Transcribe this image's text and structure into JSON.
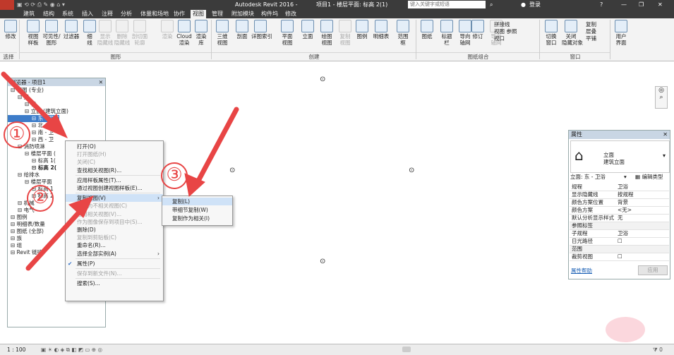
{
  "titlebar": {
    "app_title": "Autodesk Revit 2016 -",
    "doc_title": "项目1 - 楼层平面: 标高 2(1)",
    "search_placeholder": "键入关键字或短语",
    "login": "登录"
  },
  "tabs": [
    "建筑",
    "结构",
    "系统",
    "插入",
    "注释",
    "分析",
    "体量和场地",
    "协作",
    "视图",
    "管理",
    "附加模块",
    "构件坞",
    "修改"
  ],
  "active_tab": "视图",
  "ribbon": {
    "buttons": [
      {
        "label": "修改",
        "dim": false
      },
      {
        "label": "视图\n样板",
        "dim": false
      },
      {
        "label": "可见性/\n图形",
        "dim": false
      },
      {
        "label": "过滤器",
        "dim": false
      },
      {
        "label": "细\n线",
        "dim": false
      },
      {
        "label": "显示\n隐藏线",
        "dim": true
      },
      {
        "label": "删除\n隐藏线",
        "dim": true
      },
      {
        "label": "剖切面\n轮廓",
        "dim": true
      },
      {
        "label": "渲染",
        "dim": true
      },
      {
        "label": "Cloud\n渲染",
        "dim": false
      },
      {
        "label": "渲染\n库",
        "dim": false
      },
      {
        "label": "三维\n视图",
        "dim": false
      },
      {
        "label": "剖面",
        "dim": false
      },
      {
        "label": "详图索引",
        "dim": false
      },
      {
        "label": "平面\n视图",
        "dim": false
      },
      {
        "label": "立面",
        "dim": false
      },
      {
        "label": "绘图\n视图",
        "dim": false
      },
      {
        "label": "复制\n视图",
        "dim": true
      },
      {
        "label": "图例",
        "dim": false
      },
      {
        "label": "明细表",
        "dim": false
      },
      {
        "label": "范围\n框",
        "dim": false
      },
      {
        "label": "图纸",
        "dim": false
      },
      {
        "label": "标题\n栏",
        "dim": false
      },
      {
        "label": "导向\n轴网",
        "dim": false
      },
      {
        "label": "修订",
        "dim": false
      },
      {
        "label": "导向\n轴网",
        "dim": true
      },
      {
        "label": "切换\n窗口",
        "dim": false
      },
      {
        "label": "关闭\n隐藏对象",
        "dim": false
      },
      {
        "label": "用户\n界面",
        "dim": false
      }
    ],
    "small_items": [
      "拼接线",
      "视图 参照",
      "视口",
      "复制",
      "层叠",
      "平铺"
    ],
    "groups": {
      "select": "选择",
      "graphics": "图形",
      "create": "创建",
      "sheet": "图纸组合",
      "window": "窗口"
    }
  },
  "browser": {
    "title": "浏览器 - 项目1",
    "items": [
      {
        "text": "视图 (专业)",
        "indent": 1
      },
      {
        "text": "卫",
        "indent": 2
      },
      {
        "text": "楼",
        "indent": 3
      },
      {
        "text": "立面 (建筑立面)",
        "indent": 3
      },
      {
        "text": "东 - 卫浴",
        "indent": 4,
        "selected": true
      },
      {
        "text": "北 - 卫",
        "indent": 4
      },
      {
        "text": "南 - 卫",
        "indent": 4
      },
      {
        "text": "西 - 卫",
        "indent": 4
      },
      {
        "text": "消防喷淋",
        "indent": 2
      },
      {
        "text": "楼层平面 (",
        "indent": 3
      },
      {
        "text": "标高 1(",
        "indent": 4
      },
      {
        "text": "标高 2(",
        "indent": 4,
        "bold": true
      },
      {
        "text": "给排水",
        "indent": 2
      },
      {
        "text": "楼层平面",
        "indent": 3
      },
      {
        "text": "标高 1",
        "indent": 4
      },
      {
        "text": "标高 2",
        "indent": 4
      },
      {
        "text": "机械",
        "indent": 2
      },
      {
        "text": "电气",
        "indent": 2
      },
      {
        "text": "图例",
        "indent": 1
      },
      {
        "text": "明细表/数量",
        "indent": 1
      },
      {
        "text": "图纸 (全部)",
        "indent": 1
      },
      {
        "text": "族",
        "indent": 1
      },
      {
        "text": "组",
        "indent": 1
      },
      {
        "text": "Revit 链接",
        "indent": 1
      }
    ]
  },
  "context_menu": {
    "items": [
      {
        "label": "打开(O)",
        "dis": false
      },
      {
        "label": "打开图纸(H)",
        "dis": true
      },
      {
        "label": "关闭(C)",
        "dis": true
      },
      {
        "label": "查找相关视图(R)...",
        "dis": false
      },
      {
        "sep": true
      },
      {
        "label": "应用样板属性(T)...",
        "dis": false
      },
      {
        "label": "通过视图创建视图样板(E)...",
        "dis": false
      },
      {
        "sep": true
      },
      {
        "label": "复制视图(V)",
        "dis": false,
        "hl": true,
        "arrow": "›"
      },
      {
        "label": "转换为不相关视图(C)",
        "dis": true
      },
      {
        "label": "应用相关视图(V)...",
        "dis": true
      },
      {
        "label": "作为图像保存到项目中(S)...",
        "dis": true
      },
      {
        "label": "删除(D)",
        "dis": false
      },
      {
        "label": "复制到剪贴板(C)",
        "dis": true
      },
      {
        "label": "重命名(R)...",
        "dis": false
      },
      {
        "label": "选择全部实例(A)",
        "dis": false,
        "arrow": "›"
      },
      {
        "sep": true
      },
      {
        "label": "属性(P)",
        "dis": false,
        "check": "✔"
      },
      {
        "sep": true
      },
      {
        "label": "保存到新文件(N)...",
        "dis": true
      },
      {
        "sep": true
      },
      {
        "label": "搜索(S)...",
        "dis": false
      }
    ]
  },
  "submenu": {
    "items": [
      {
        "label": "复制(L)",
        "hl": true
      },
      {
        "label": "带细节复制(W)",
        "hl": false
      },
      {
        "label": "复制作为相关(I)",
        "hl": false
      }
    ]
  },
  "properties": {
    "title": "属性",
    "family_line1": "立面",
    "family_line2": "建筑立面",
    "type_selector": "立面: 东 - 卫浴",
    "edit_type": "编辑类型",
    "rows": [
      {
        "k": "规程",
        "v": "卫浴"
      },
      {
        "k": "显示隐藏线",
        "v": "按规程"
      },
      {
        "k": "颜色方案位置",
        "v": "背景"
      },
      {
        "k": "颜色方案",
        "v": "<无>"
      },
      {
        "k": "默认分析显示样式",
        "v": "无"
      },
      {
        "k": "参照标签",
        "v": ""
      },
      {
        "k": "子规程",
        "v": "卫浴"
      },
      {
        "k": "日光路径",
        "v": "☐"
      },
      {
        "k": "范围",
        "v": ""
      },
      {
        "k": "裁剪视图",
        "v": "☐"
      }
    ],
    "help_link": "属性帮助",
    "apply": "应用"
  },
  "statusbar": {
    "scale": "1 : 100"
  },
  "annotations": {
    "n1": "①",
    "n2": "②",
    "n3": "③",
    "arrow_color": "#e84545"
  },
  "colors": {
    "selection": "#3d7cc9",
    "menu_highlight": "#cfe2f7",
    "titlebar": "#3b3b3b"
  }
}
